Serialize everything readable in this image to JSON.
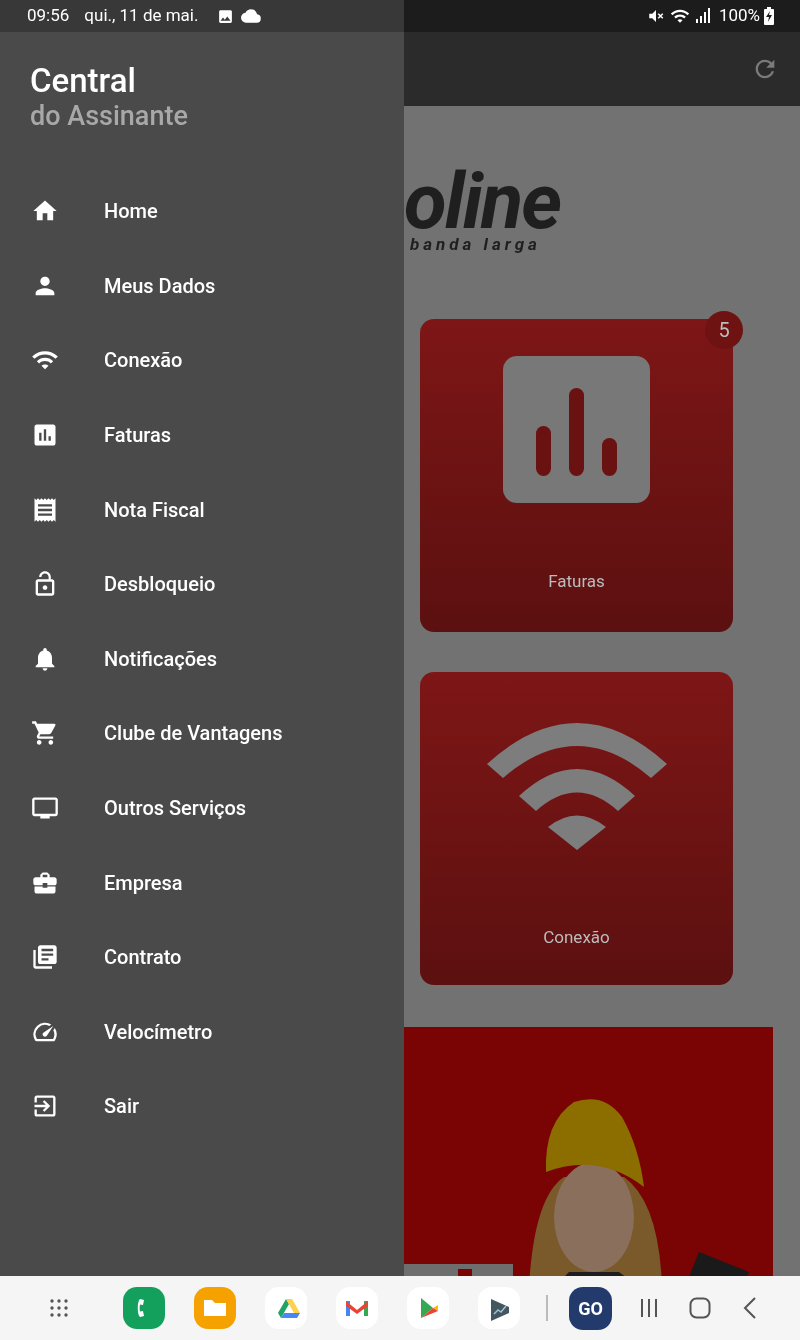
{
  "status_bar": {
    "time": "09:56",
    "date": "qui., 11 de mai.",
    "battery": "100%"
  },
  "drawer": {
    "title": "Central",
    "subtitle": "do Assinante",
    "items": [
      {
        "label": "Home"
      },
      {
        "label": "Meus Dados"
      },
      {
        "label": "Conexão"
      },
      {
        "label": "Faturas"
      },
      {
        "label": "Nota Fiscal"
      },
      {
        "label": "Desbloqueio"
      },
      {
        "label": "Notificações"
      },
      {
        "label": "Clube de Vantagens"
      },
      {
        "label": "Outros Serviços"
      },
      {
        "label": "Empresa"
      },
      {
        "label": "Contrato"
      },
      {
        "label": "Velocímetro"
      },
      {
        "label": "Sair"
      }
    ]
  },
  "content": {
    "logo_wordmark": "oline",
    "logo_tagline": "banda larga",
    "cards": [
      {
        "label": "Faturas",
        "badge": "5"
      },
      {
        "label": "Conexão"
      }
    ]
  },
  "nav_bar": {
    "pinned_app_label": "GO"
  }
}
